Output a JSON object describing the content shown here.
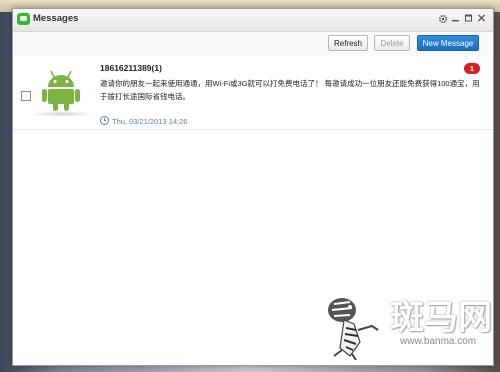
{
  "window": {
    "title": "Messages"
  },
  "toolbar": {
    "refresh_label": "Refresh",
    "delete_label": "Delete",
    "new_message_label": "New Message"
  },
  "messages": [
    {
      "sender": "18616211389(1)",
      "unread_count": "1",
      "body": "邀请你的朋友一起来使用通通，用Wi-Fi或3G就可以打免费电话了！ 每邀请成功一位朋友还能免费获得100通宝，用于拨打长途国际省钱电话。",
      "timestamp": "Thu, 03/21/2013 14:26"
    }
  ],
  "watermark": {
    "brand": "斑马网",
    "url": "www.banma.com"
  },
  "colors": {
    "accent": "#1b6fc4",
    "badge": "#d42020",
    "android_green": "#7cb342",
    "timestamp": "#5a80b0"
  }
}
